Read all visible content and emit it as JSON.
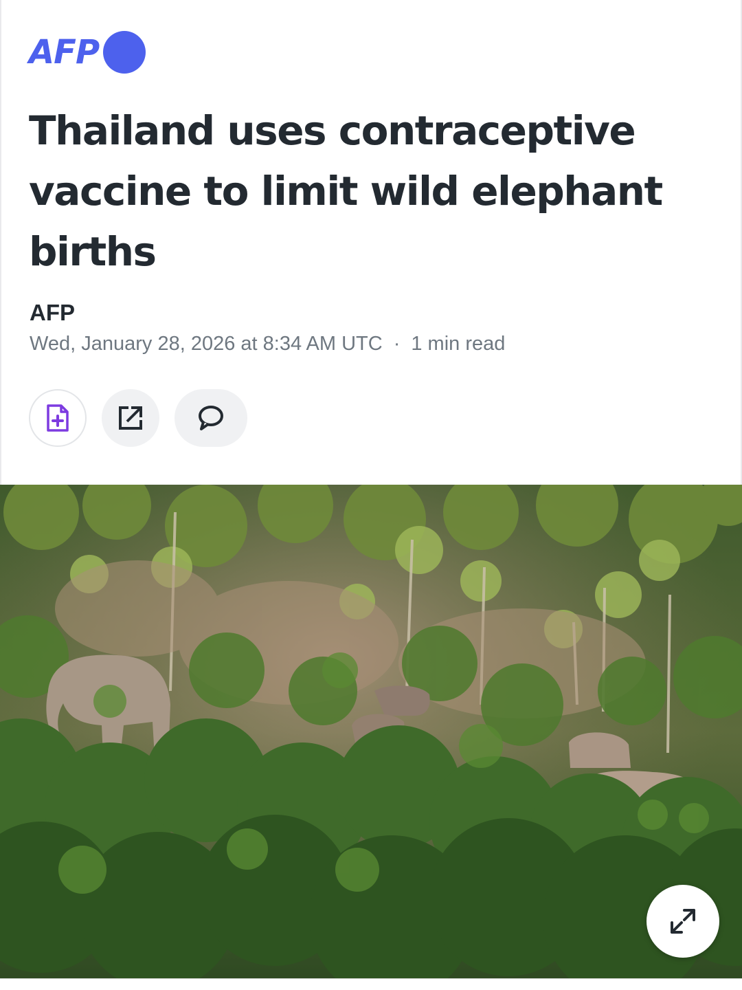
{
  "brand": {
    "logo_text": "AFP",
    "accent_color": "#4d61ed"
  },
  "article": {
    "headline": "Thailand uses contraceptive vaccine to limit wild elephant births",
    "author": "AFP",
    "published": "Wed, January 28, 2026 at 8:34 AM UTC",
    "separator": "·",
    "read_time": "1 min read"
  },
  "actions": {
    "save_icon": "add-document-icon",
    "share_icon": "external-share-icon",
    "comment_icon": "speech-bubble-icon"
  },
  "hero_image": {
    "subject": "wild elephants in forest",
    "expand_icon": "expand-arrows-icon"
  },
  "colors": {
    "text": "#232a31",
    "meta": "#6e7780",
    "save_icon": "#7d3be0",
    "button_bg": "#f0f1f3"
  }
}
